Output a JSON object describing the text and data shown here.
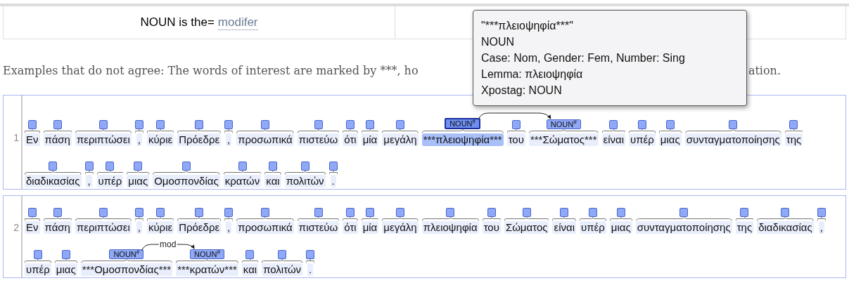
{
  "header": {
    "cells": [
      {
        "text": "NOUN is the= ",
        "link": "modifer"
      }
    ]
  },
  "intro": {
    "start": "Examples that do not agree: The words of interest are marked by ***, ho",
    "end": "ation."
  },
  "sentences": [
    {
      "number": "1",
      "lines": [
        {
          "tokens": [
            {
              "text": "Εν",
              "selected": false
            },
            {
              "text": "πάση",
              "selected": false
            },
            {
              "text": "περιπτώσει",
              "selected": false
            },
            {
              "text": ",",
              "selected": false
            },
            {
              "text": "κύριε",
              "selected": false
            },
            {
              "text": "Πρόεδρε",
              "selected": false
            },
            {
              "text": ",",
              "selected": false
            },
            {
              "text": "προσωπικά",
              "selected": false
            },
            {
              "text": "πιστεύω",
              "selected": false
            },
            {
              "text": "ότι",
              "selected": false
            },
            {
              "text": "μία",
              "selected": false
            },
            {
              "text": "μεγάλη",
              "selected": false
            },
            {
              "text": "***πλειοψηφία***",
              "label": "NOUN$^{#}$",
              "kind": "arc_source",
              "selected": true
            },
            {
              "text": "του",
              "selected": false
            },
            {
              "text": "***Σώματος***",
              "label": "NOUN$^{#}$",
              "kind": "arc_target",
              "selected": false
            },
            {
              "text": "είναι",
              "selected": false
            },
            {
              "text": "υπέρ",
              "selected": false
            },
            {
              "text": "μιας",
              "selected": false
            },
            {
              "text": "συνταγματοποίησης",
              "selected": false
            },
            {
              "text": "της",
              "selected": false
            }
          ]
        },
        {
          "tokens": [
            {
              "text": "διαδικασίας",
              "selected": false
            },
            {
              "text": ",",
              "selected": false
            },
            {
              "text": "υπέρ",
              "selected": false
            },
            {
              "text": "μιας",
              "selected": false
            },
            {
              "text": "Ομοσπονδίας",
              "selected": false
            },
            {
              "text": "κρατών",
              "selected": false
            },
            {
              "text": "και",
              "selected": false
            },
            {
              "text": "πολιτών",
              "selected": false
            },
            {
              "text": ".",
              "selected": false
            }
          ]
        }
      ]
    },
    {
      "number": "2",
      "lines": [
        {
          "tokens": [
            {
              "text": "Εν",
              "selected": false
            },
            {
              "text": "πάση",
              "selected": false
            },
            {
              "text": "περιπτώσει",
              "selected": false
            },
            {
              "text": ",",
              "selected": false
            },
            {
              "text": "κύριε",
              "selected": false
            },
            {
              "text": "Πρόεδρε",
              "selected": false
            },
            {
              "text": ",",
              "selected": false
            },
            {
              "text": "προσωπικά",
              "selected": false
            },
            {
              "text": "πιστεύω",
              "selected": false
            },
            {
              "text": "ότι",
              "selected": false
            },
            {
              "text": "μία",
              "selected": false
            },
            {
              "text": "μεγάλη",
              "selected": false
            },
            {
              "text": "πλειοψηφία",
              "selected": false
            },
            {
              "text": "του",
              "selected": false
            },
            {
              "text": "Σώματος",
              "selected": false
            },
            {
              "text": "είναι",
              "selected": false
            },
            {
              "text": "υπέρ",
              "selected": false
            },
            {
              "text": "μιας",
              "selected": false
            },
            {
              "text": "συνταγματοποίησης",
              "selected": false
            },
            {
              "text": "της",
              "selected": false
            },
            {
              "text": "διαδικασίας",
              "selected": false
            },
            {
              "text": ",",
              "selected": false
            }
          ]
        },
        {
          "tokens": [
            {
              "text": "υπέρ",
              "selected": false
            },
            {
              "text": "μιας",
              "selected": false
            },
            {
              "text": "***Ομοσπονδίας***",
              "label": "NOUN$^{#}$",
              "kind": "arc_source",
              "arc_label": "mod",
              "selected": false
            },
            {
              "text": "***κρατών***",
              "label": "NOUN$^{#}$",
              "kind": "arc_target",
              "selected": false
            },
            {
              "text": "και",
              "selected": false
            },
            {
              "text": "πολιτών",
              "selected": false
            },
            {
              "text": ".",
              "selected": false
            }
          ]
        }
      ]
    }
  ],
  "tooltip": {
    "lines": [
      "\"***πλειοψηφία***\"",
      "NOUN",
      "Case: Nom, Gender: Fem, Number: Sing",
      "Lemma: πλειοψηφία",
      "Xpostag: NOUN"
    ]
  }
}
